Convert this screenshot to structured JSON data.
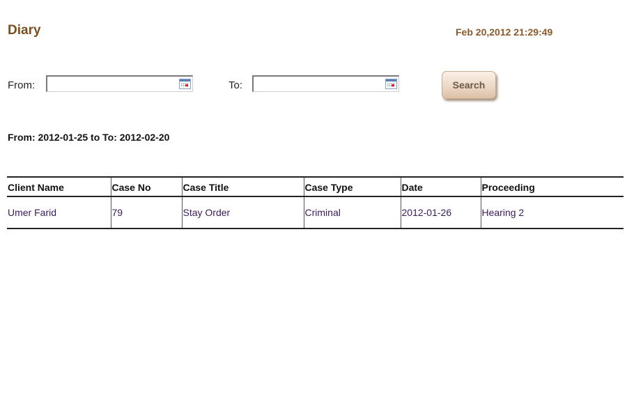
{
  "header": {
    "title": "Diary",
    "datetime": "Feb 20,2012 21:29:49"
  },
  "filter": {
    "from_label": "From:",
    "from_value": "",
    "to_label": "To:",
    "to_value": "",
    "search_label": "Search",
    "calendar_icon": "calendar-icon"
  },
  "range_summary": "From: 2012-01-25  to  To: 2012-02-20",
  "table": {
    "columns": [
      "Client Name",
      "Case No",
      "Case Title",
      "Case Type",
      "Date",
      "Proceeding"
    ],
    "rows": [
      [
        "Umer Farid",
        "79",
        "Stay Order",
        "Criminal",
        "2012-01-26",
        "Hearing 2"
      ]
    ]
  },
  "colors": {
    "title": "#7a5020",
    "datetime": "#8a5a2b",
    "cell_text": "#3a1a5a",
    "button_bg": "#ecd9c6"
  }
}
